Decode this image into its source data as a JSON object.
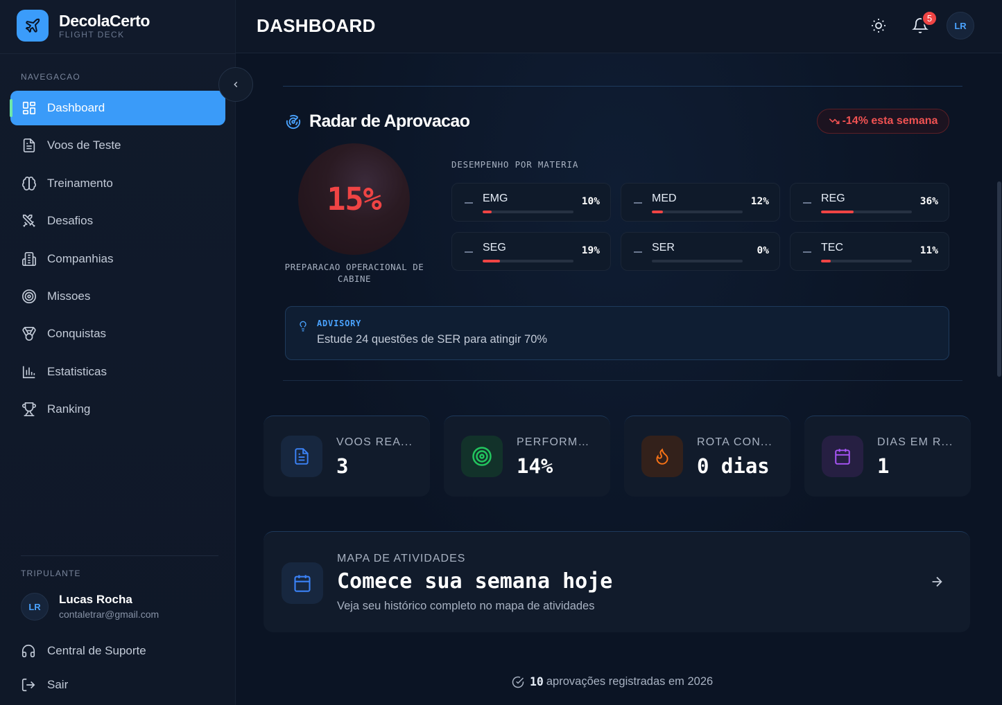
{
  "brand": {
    "name": "DecolaCerto",
    "subtitle": "FLIGHT DECK"
  },
  "sidebar": {
    "nav_section": "NAVEGACAO",
    "items": [
      {
        "label": "Dashboard",
        "icon": "dashboard-icon",
        "active": true
      },
      {
        "label": "Voos de Teste",
        "icon": "document-icon"
      },
      {
        "label": "Treinamento",
        "icon": "brain-icon"
      },
      {
        "label": "Desafios",
        "icon": "swords-icon"
      },
      {
        "label": "Companhias",
        "icon": "building-icon"
      },
      {
        "label": "Missoes",
        "icon": "target-icon"
      },
      {
        "label": "Conquistas",
        "icon": "medal-icon"
      },
      {
        "label": "Estatisticas",
        "icon": "bar-chart-icon"
      },
      {
        "label": "Ranking",
        "icon": "trophy-icon"
      }
    ],
    "crew_section": "TRIPULANTE",
    "user": {
      "initials": "LR",
      "name": "Lucas Rocha",
      "email": "contaletrar@gmail.com"
    },
    "support_label": "Central de Suporte",
    "logout_label": "Sair"
  },
  "header": {
    "title": "DASHBOARD",
    "notification_count": "5",
    "avatar_initials": "LR"
  },
  "radar": {
    "title": "Radar de Aprovacao",
    "trend": "-14% esta semana",
    "gauge_value": "15%",
    "gauge_label": "PREPARACAO OPERACIONAL DE CABINE",
    "performance_label": "DESEMPENHO POR MATERIA",
    "subjects": [
      {
        "name": "EMG",
        "pct": "10%",
        "value": 10
      },
      {
        "name": "MED",
        "pct": "12%",
        "value": 12
      },
      {
        "name": "REG",
        "pct": "36%",
        "value": 36
      },
      {
        "name": "SEG",
        "pct": "19%",
        "value": 19
      },
      {
        "name": "SER",
        "pct": "0%",
        "value": 0
      },
      {
        "name": "TEC",
        "pct": "11%",
        "value": 11
      }
    ],
    "advisory": {
      "title": "ADVISORY",
      "text": "Estude 24 questões de SER para atingir 70%"
    }
  },
  "stats": [
    {
      "label": "VOOS REA...",
      "value": "3",
      "icon": "document-icon",
      "color": "#3b82f6"
    },
    {
      "label": "PERFORMA...",
      "value": "14%",
      "icon": "target-icon",
      "color": "#22c55e"
    },
    {
      "label": "ROTA CON...",
      "value": "0 dias",
      "icon": "flame-icon",
      "color": "#f97316"
    },
    {
      "label": "DIAS EM R...",
      "value": "1",
      "icon": "calendar-icon",
      "color": "#a855f7"
    }
  ],
  "activity_map": {
    "small_label": "MAPA DE ATIVIDADES",
    "title": "Comece sua semana hoje",
    "subtitle": "Veja seu histórico completo no mapa de atividades"
  },
  "footer": {
    "count": "10",
    "text": "aprovações registradas em 2026"
  },
  "colors": {
    "accent": "#3a9bf9",
    "danger": "#ef4444",
    "background": "#0b1424"
  }
}
